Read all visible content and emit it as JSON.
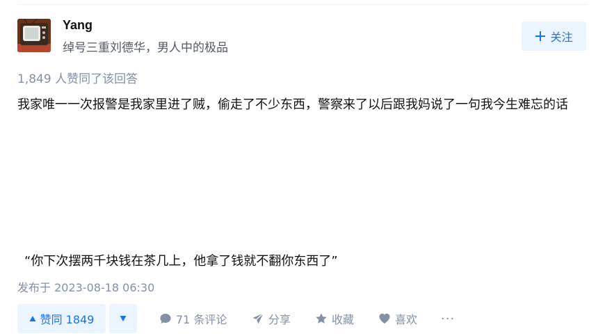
{
  "author": {
    "name": "Yang",
    "bio": "绰号三重刘德华，男人中的极品"
  },
  "follow_button": {
    "icon": "plus-icon",
    "label": "关注"
  },
  "vote_summary": "1,849 人赞同了该回答",
  "answer": {
    "paragraph1": "我家唯一一次报警是我家里进了贼，偷走了不少东西，警察来了以后跟我妈说了一句我今生难忘的话",
    "quote": "“你下次摆两千块钱在茶几上，他拿了钱就不翻你东西了”"
  },
  "published": "发布于 2023-08-18 06:30",
  "actions": {
    "vote_up": {
      "icon": "triangle-up-icon",
      "label": "赞同 1849"
    },
    "vote_down": {
      "icon": "triangle-down-icon"
    },
    "comment": {
      "icon": "comment-icon",
      "label": "71 条评论"
    },
    "share": {
      "icon": "paper-plane-icon",
      "label": "分享"
    },
    "collect": {
      "icon": "star-icon",
      "label": "收藏"
    },
    "like": {
      "icon": "heart-icon",
      "label": "喜欢"
    },
    "more": {
      "icon": "ellipsis-icon",
      "label": "···"
    }
  },
  "colors": {
    "accent": "#1772f6",
    "accent_bg": "#ebf5ff",
    "meta": "#8491a5",
    "text": "#121212"
  }
}
